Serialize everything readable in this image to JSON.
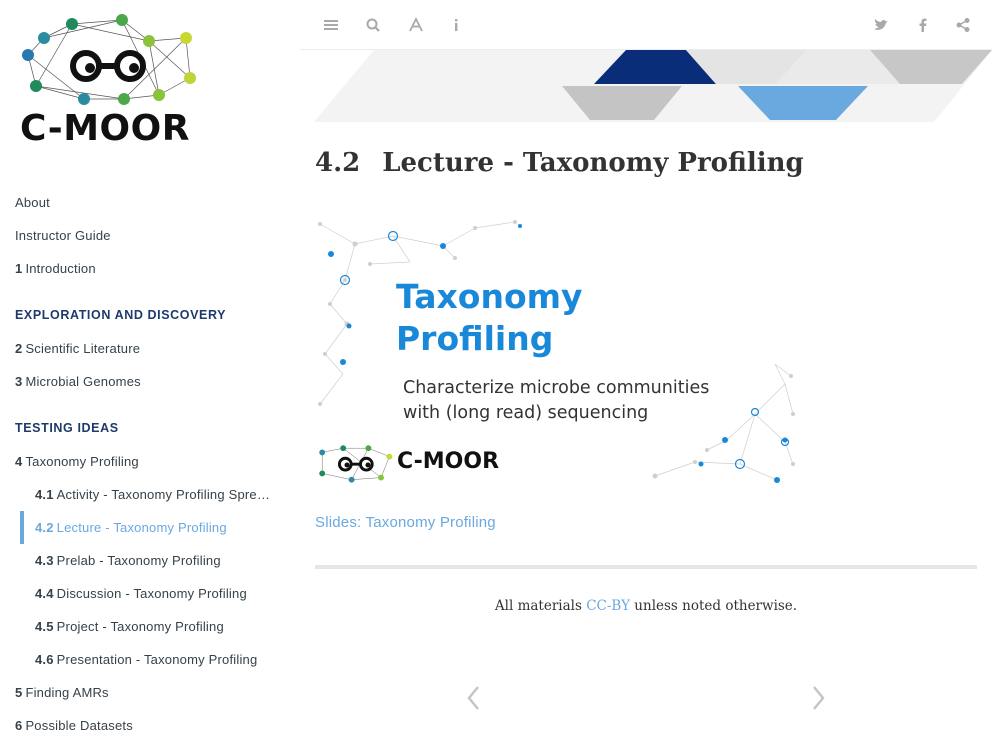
{
  "logo": {
    "text": "C-MOOR"
  },
  "topbar": {
    "icons": [
      "menu-icon",
      "search-icon",
      "font-icon",
      "info-icon",
      "twitter-icon",
      "facebook-icon",
      "share-icon"
    ]
  },
  "sidebar": {
    "items": [
      {
        "num": "",
        "label": "About"
      },
      {
        "num": "",
        "label": "Instructor Guide"
      },
      {
        "num": "1",
        "label": "Introduction"
      },
      {
        "header": "EXPLORATION AND DISCOVERY"
      },
      {
        "num": "2",
        "label": "Scientific Literature"
      },
      {
        "num": "3",
        "label": "Microbial Genomes"
      },
      {
        "header": "TESTING IDEAS"
      },
      {
        "num": "4",
        "label": "Taxonomy Profiling"
      },
      {
        "num": "4.1",
        "label": "Activity - Taxonomy Profiling Spre…"
      },
      {
        "num": "4.2",
        "label": "Lecture - Taxonomy Profiling"
      },
      {
        "num": "4.3",
        "label": "Prelab - Taxonomy Profiling"
      },
      {
        "num": "4.4",
        "label": "Discussion - Taxonomy Profiling"
      },
      {
        "num": "4.5",
        "label": "Project - Taxonomy Profiling"
      },
      {
        "num": "4.6",
        "label": "Presentation - Taxonomy Profiling"
      },
      {
        "num": "5",
        "label": "Finding AMRs"
      },
      {
        "num": "6",
        "label": "Possible Datasets"
      }
    ]
  },
  "page": {
    "section_num": "4.2",
    "title": "Lecture - Taxonomy Profiling",
    "slide": {
      "title_line1": "Taxonomy",
      "title_line2": "Profiling",
      "subtitle_line1": "Characterize microbe communities",
      "subtitle_line2": "with (long read) sequencing",
      "logo_text": "C-MOOR"
    },
    "slides_link": "Slides: Taxonomy Profiling",
    "footer_pre": "All materials ",
    "footer_link": "CC-BY",
    "footer_post": " unless noted otherwise."
  },
  "colors": {
    "accent": "#6aa8e0",
    "slide_blue": "#1a88d8",
    "banner_navy": "#0a2d7a"
  }
}
